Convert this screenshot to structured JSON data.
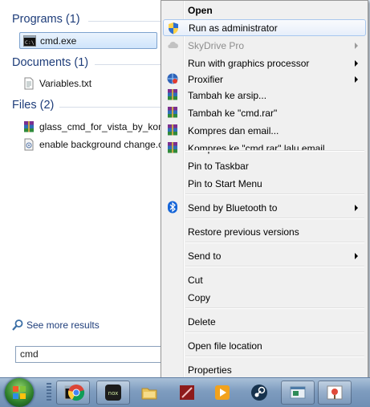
{
  "start_menu": {
    "groups": [
      {
        "heading": "Programs (1)",
        "items": [
          {
            "label": "cmd.exe",
            "icon": "cmd-icon"
          }
        ]
      },
      {
        "heading": "Documents (1)",
        "items": [
          {
            "label": "Variables.txt",
            "icon": "text-document-icon"
          }
        ]
      },
      {
        "heading": "Files (2)",
        "items": [
          {
            "label": "glass_cmd_for_vista_by_kom",
            "icon": "rar-archive-icon"
          },
          {
            "label": "enable background change.c",
            "icon": "file-icon"
          }
        ]
      }
    ],
    "see_more": "See more results",
    "search_value": "cmd"
  },
  "context_menu": {
    "items": [
      {
        "label": "Open",
        "bold": true
      },
      {
        "label": "Run as administrator",
        "icon": "uac-shield-icon",
        "highlighted": true
      },
      {
        "label": "SkyDrive Pro",
        "icon": "skydrive-cloud-icon",
        "disabled": true,
        "submenu": true
      },
      {
        "label": "Run with graphics processor",
        "submenu": true
      },
      {
        "label": "Proxifier",
        "icon": "proxifier-icon",
        "submenu": true
      },
      {
        "label": "Tambah ke arsip...",
        "icon": "winrar-icon"
      },
      {
        "label": "Tambah ke \"cmd.rar\"",
        "icon": "winrar-icon"
      },
      {
        "label": "Kompres dan email...",
        "icon": "winrar-icon"
      },
      {
        "label": "Kompres ke \"cmd.rar\" lalu email",
        "icon": "winrar-icon"
      },
      {
        "label": "Pin to Taskbar"
      },
      {
        "label": "Pin to Start Menu"
      },
      {
        "label": "Send by Bluetooth to",
        "icon": "bluetooth-icon",
        "submenu": true
      },
      {
        "label": "Restore previous versions"
      },
      {
        "label": "Send to",
        "submenu": true
      },
      {
        "label": "Cut"
      },
      {
        "label": "Copy"
      },
      {
        "label": "Delete"
      },
      {
        "label": "Open file location"
      },
      {
        "label": "Properties"
      }
    ]
  },
  "taskbar": {
    "pinned": [
      "cmd-taskbar-icon",
      "chrome-icon",
      "nox-icon",
      "explorer-folder-icon",
      "app-red-icon",
      "media-player-icon",
      "steam-icon",
      "window-app-icon",
      "paint-icon"
    ]
  },
  "colors": {
    "menu_bg": "#f0f0f0",
    "highlight_border": "#a8c7ee",
    "heading_blue": "#1e3d7a"
  }
}
